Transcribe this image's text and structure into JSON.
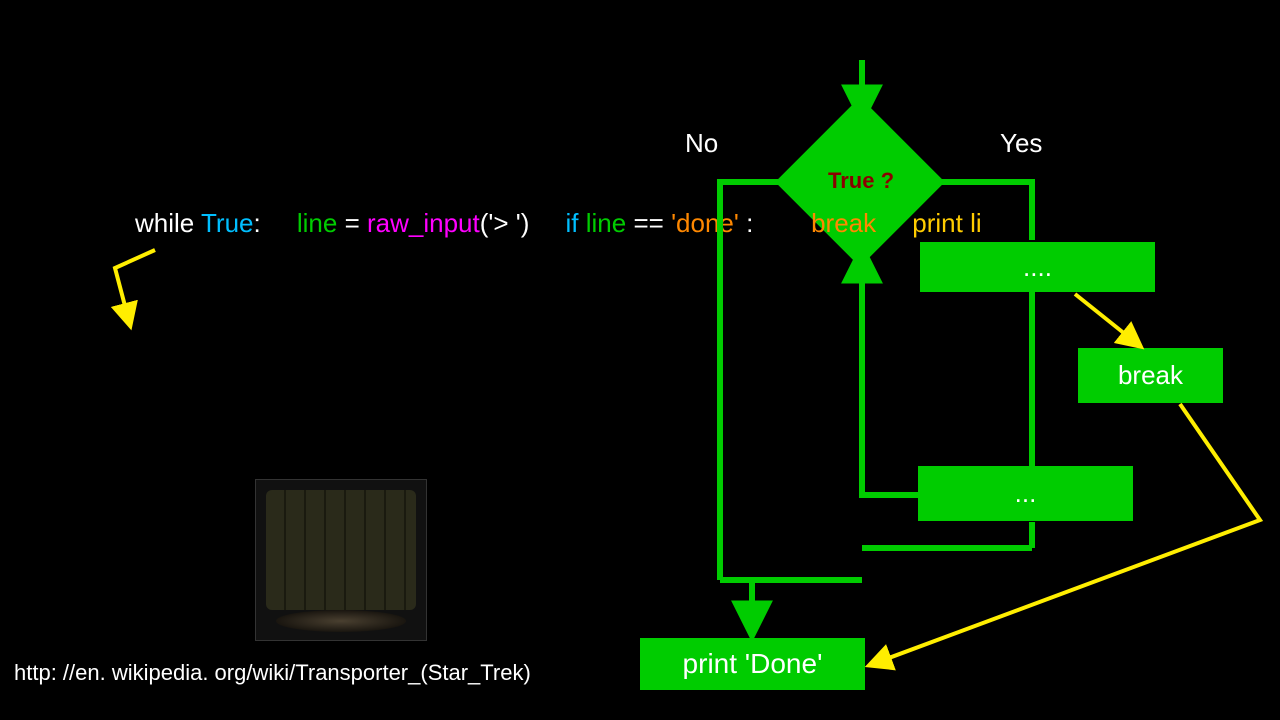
{
  "labels": {
    "no": "No",
    "yes": "Yes",
    "decision": "True ?"
  },
  "code": {
    "while_kw": "while ",
    "true_kw": "True",
    "colon": ":",
    "line_var": "line",
    "assign": " = ",
    "raw_input": "raw_input",
    "arg": "('> ')",
    "if_kw": "if ",
    "cond_var": "line",
    "eq": " == ",
    "done_lit": "'done'",
    "cond_colon": " :",
    "break_kw": "break",
    "print_kw": "print ",
    "print_arg": "li"
  },
  "boxes": {
    "box1": "....",
    "break": "break",
    "box2": "...",
    "print_done": "print 'Done'"
  },
  "url": "http: //en. wikipedia. org/wiki/Transporter_(Star_Trek)"
}
